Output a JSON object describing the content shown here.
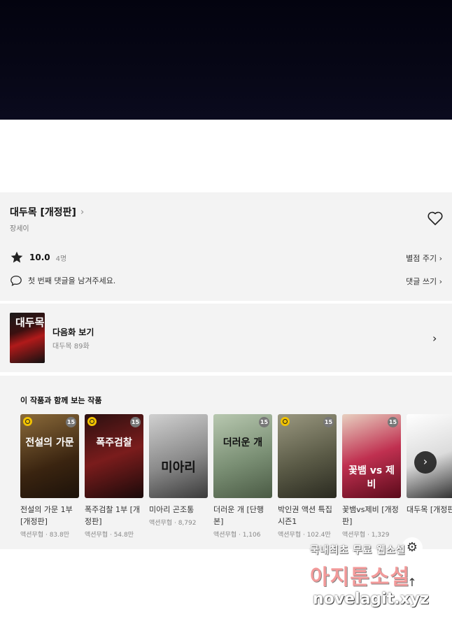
{
  "work": {
    "title": "대두목 [개정판]",
    "title_chevron": "›",
    "author": "장세이",
    "rating_score": "10.0",
    "rating_count": "4명",
    "rate_link": "별점 주기 ›",
    "comment_prompt": "첫 번째 댓글을 남겨주세요.",
    "write_link": "댓글 쓰기 ›"
  },
  "next_episode": {
    "title": "다음화 보기",
    "subtitle": "대두목 89화",
    "thumb_text": "대두목",
    "chevron": "›"
  },
  "related": {
    "section_title": "이 작품과 함께 보는 작품",
    "items": [
      {
        "title": "전설의 가문 1부 [개정판]",
        "meta": "액션무협 · 83.8만",
        "badge": "15",
        "cover_text": "전설의 가문",
        "color": "#5a3a22"
      },
      {
        "title": "폭주검찰 1부 [개정판]",
        "meta": "액션무협 · 54.8만",
        "badge": "15",
        "cover_text": "폭주검찰",
        "color": "#6a1a1a"
      },
      {
        "title": "미아리 곤조통",
        "meta": "액션무협 · 8,792",
        "badge": "",
        "cover_text": "미아리",
        "color": "#b5b5b5"
      },
      {
        "title": "더러운 개 [단행본]",
        "meta": "액션무협 · 1,106",
        "badge": "15",
        "cover_text": "더러운 개",
        "color": "#8aa08a"
      },
      {
        "title": "박인권 액션 특집 시즌1",
        "meta": "액션무협 · 102.4만",
        "badge": "15",
        "cover_text": "",
        "color": "#6b6a55"
      },
      {
        "title": "꽃뱀vs제비 [개정판]",
        "meta": "액션무협 · 1,329",
        "badge": "15",
        "cover_text": "꽃뱀 vs 제비",
        "color": "#b02a4a"
      },
      {
        "title": "대두목 [개정판]",
        "meta": "",
        "badge": "",
        "cover_text": "",
        "color": "#e8e8e8"
      }
    ]
  },
  "floating": {
    "settings_icon": "gear-icon",
    "top_icon": "arrow-up-icon",
    "scroll_icon": "chevron-right-icon"
  },
  "watermark": {
    "line1": "국내최초 무료 웹소설",
    "line2": "아지툰소설",
    "line3": "novelagit.xyz"
  }
}
